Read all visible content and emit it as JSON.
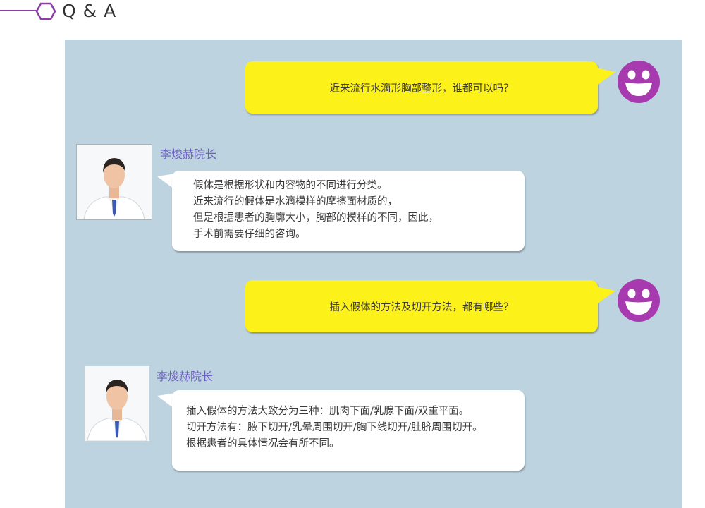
{
  "header": {
    "title": "Q & A"
  },
  "colors": {
    "accent": "#8c3da3",
    "panel": "#bdd3df",
    "question_bubble": "#fdf11a",
    "name": "#6b5fc0"
  },
  "qa": [
    {
      "question": "近来流行水滴形胸部整形，谁都可以吗？",
      "doctor_name": "李焌赫院长",
      "answer_lines": [
        "假体是根据形状和内容物的不同进行分类。",
        "近来流行的假体是水滴模样的摩擦面材质的，",
        "但是根据患者的胸廓大小，胸部的模样的不同，因此，",
        "手术前需要仔细的咨询。"
      ]
    },
    {
      "question": "插入假体的方法及切开方法，都有哪些？",
      "doctor_name": "李焌赫院长",
      "answer_lines": [
        "插入假体的方法大致分为三种：肌肉下面/乳腺下面/双重平面。",
        "切开方法有：腋下切开/乳晕周围切开/胸下线切开/肚脐周围切开。",
        "根据患者的具体情况会有所不同。"
      ]
    }
  ]
}
